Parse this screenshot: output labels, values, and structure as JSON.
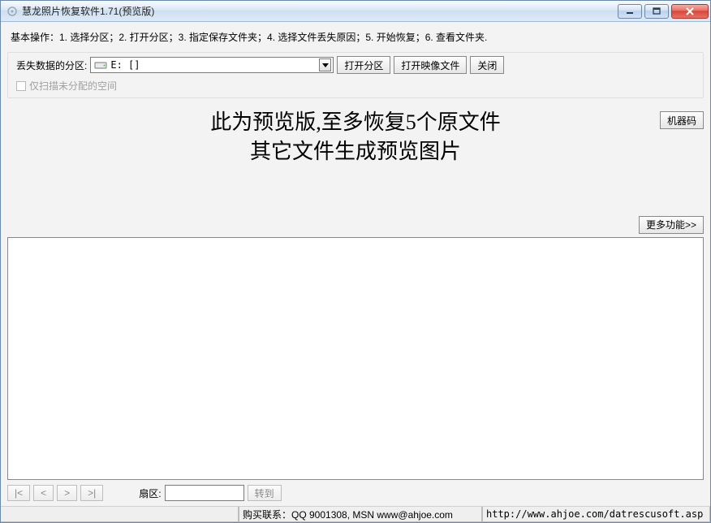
{
  "title": "慧龙照片恢复软件1.71(预览版)",
  "instructions": "基本操作：1. 选择分区；2. 打开分区；3. 指定保存文件夹；4. 选择文件丢失原因；5. 开始恢复；6. 查看文件夹.",
  "partition": {
    "label": "丢失数据的分区:",
    "selected": "E: []",
    "buttons": {
      "open_partition": "打开分区",
      "open_image": "打开映像文件",
      "close": "关闭"
    },
    "only_unallocated": "仅扫描未分配的空间"
  },
  "machine_code_btn": "机器码",
  "preview_line1": "此为预览版,至多恢复5个原文件",
  "preview_line2": "其它文件生成预览图片",
  "more_features": "更多功能>>",
  "nav": {
    "first": "|<",
    "prev": "<",
    "next": ">",
    "last": ">|"
  },
  "sector_label": "扇区:",
  "sector_value": "",
  "goto": "转到",
  "status": {
    "contact": "购买联系：QQ 9001308, MSN www@ahjoe.com",
    "url": "http://www.ahjoe.com/datrescusoft.asp"
  }
}
